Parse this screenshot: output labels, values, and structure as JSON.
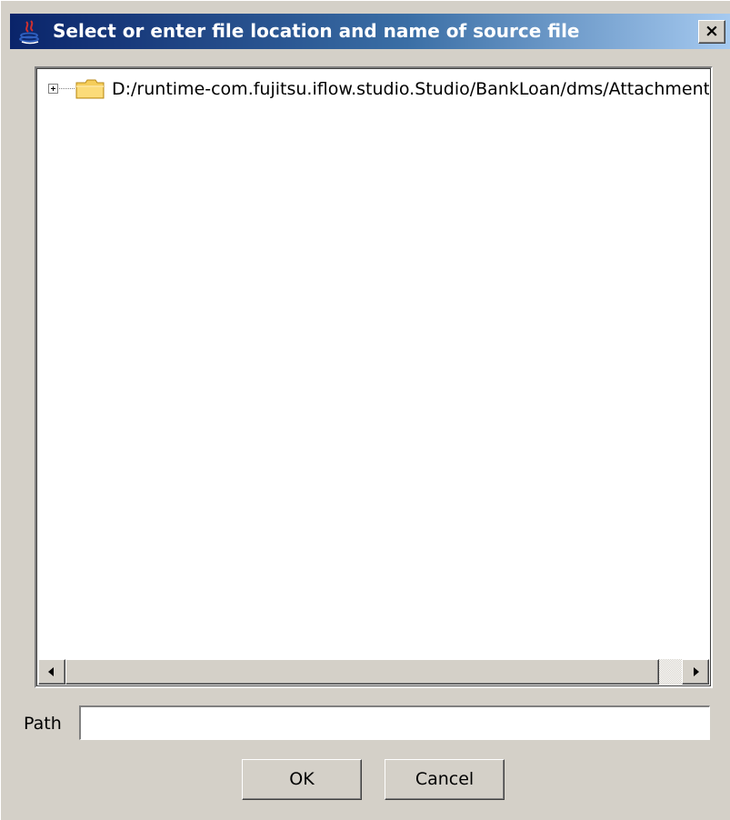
{
  "dialog": {
    "title": "Select or enter file location and name of source file",
    "close_label": "×"
  },
  "tree": {
    "items": [
      {
        "label": "D:/runtime-com.fujitsu.iflow.studio.Studio/BankLoan/dms/Attachment",
        "expanded": false,
        "icon": "folder-icon"
      }
    ]
  },
  "path": {
    "label": "Path",
    "value": "",
    "placeholder": ""
  },
  "buttons": {
    "ok_label": "OK",
    "cancel_label": "Cancel"
  },
  "colors": {
    "title_gradient_start": "#0a246a",
    "title_gradient_end": "#a6caf0",
    "dialog_background": "#d4d0c8"
  }
}
